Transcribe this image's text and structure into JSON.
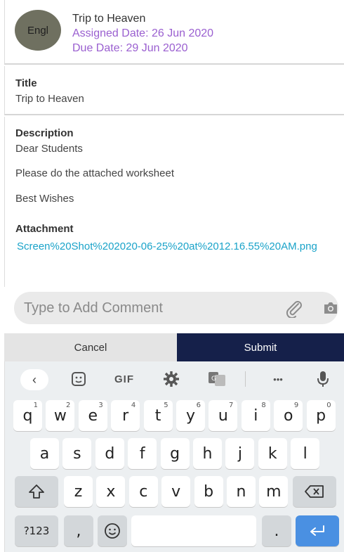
{
  "header": {
    "avatar_text": "Engl",
    "title": "Trip to Heaven",
    "assigned": "Assigned Date: 26 Jun 2020",
    "due": "Due Date: 29 Jun 2020"
  },
  "title_section": {
    "label": "Title",
    "value": "Trip to Heaven"
  },
  "description": {
    "label": "Description",
    "lines": [
      "Dear Students",
      "Please do the attached worksheet",
      "Best Wishes"
    ]
  },
  "attachment": {
    "label": "Attachment",
    "link": "Screen%20Shot%202020-06-25%20at%2012.16.55%20AM.png"
  },
  "comment": {
    "placeholder": "Type to Add Comment"
  },
  "actions": {
    "cancel": "Cancel",
    "submit": "Submit"
  },
  "keyboard": {
    "toolbar": {
      "gif": "GIF",
      "more": "•••"
    },
    "row1": [
      {
        "k": "q",
        "n": "1"
      },
      {
        "k": "w",
        "n": "2"
      },
      {
        "k": "e",
        "n": "3"
      },
      {
        "k": "r",
        "n": "4"
      },
      {
        "k": "t",
        "n": "5"
      },
      {
        "k": "y",
        "n": "6"
      },
      {
        "k": "u",
        "n": "7"
      },
      {
        "k": "i",
        "n": "8"
      },
      {
        "k": "o",
        "n": "9"
      },
      {
        "k": "p",
        "n": "0"
      }
    ],
    "row2": [
      "a",
      "s",
      "d",
      "f",
      "g",
      "h",
      "j",
      "k",
      "l"
    ],
    "row3": [
      "z",
      "x",
      "c",
      "v",
      "b",
      "n",
      "m"
    ],
    "symbols": "?123",
    "comma": ",",
    "period": ".",
    "shift_icon": "shift-icon",
    "backspace_icon": "backspace-icon",
    "enter_icon": "enter-icon"
  }
}
